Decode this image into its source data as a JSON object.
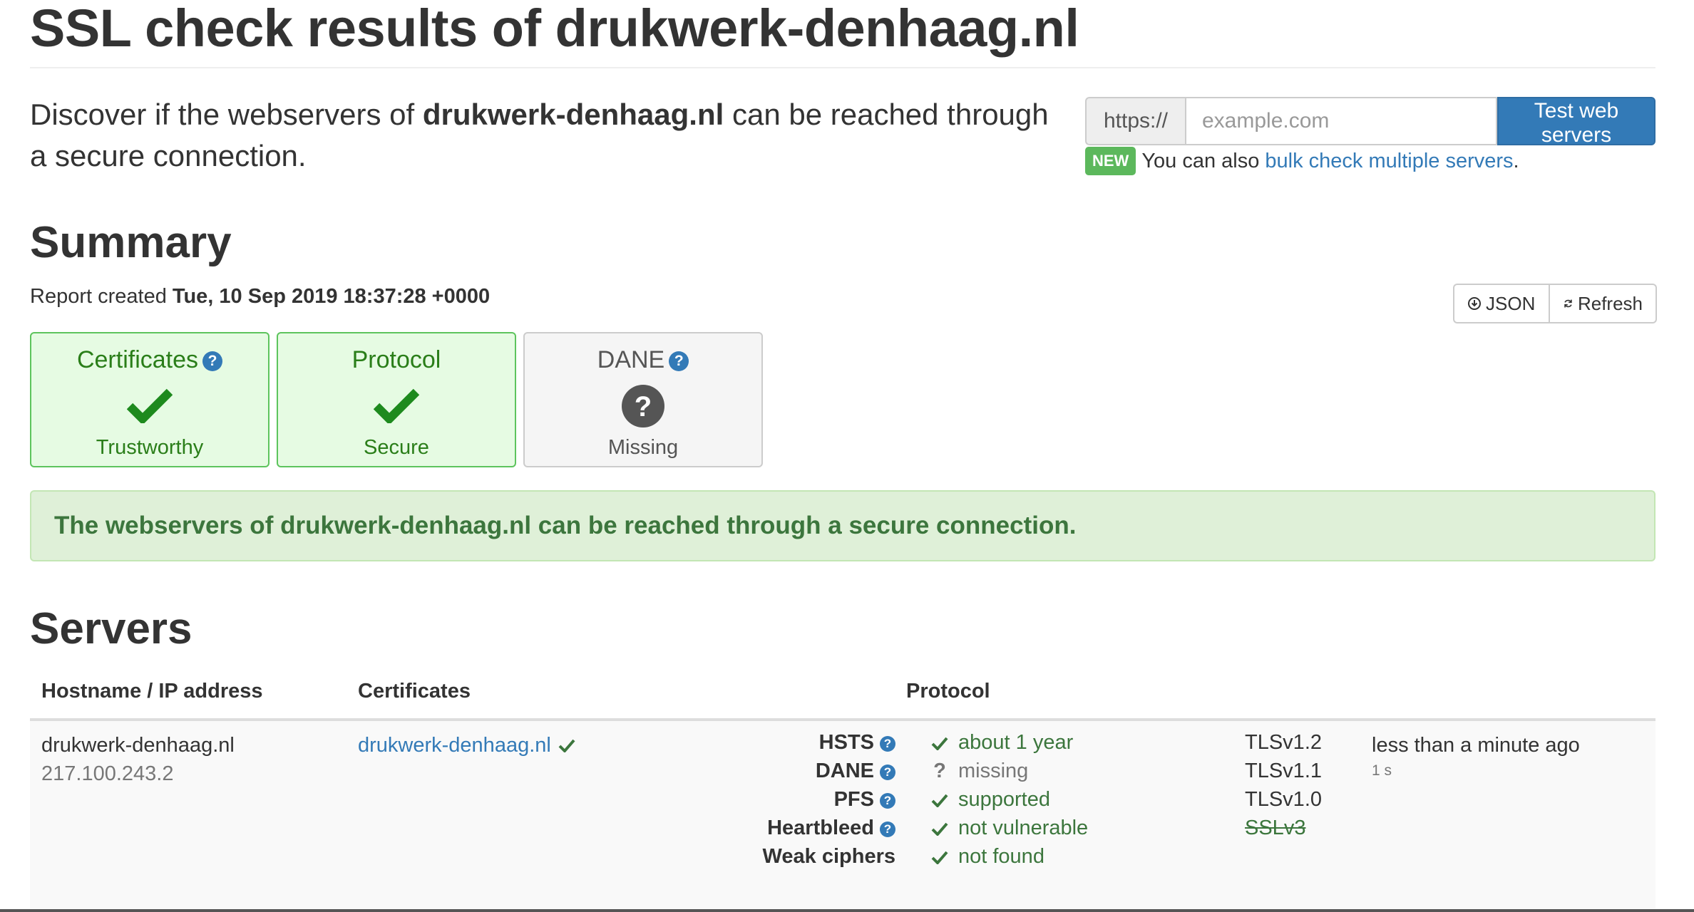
{
  "header": {
    "title": "SSL check results of drukwerk-denhaag.nl",
    "intro_prefix": "Discover if the webservers of ",
    "intro_domain": "drukwerk-denhaag.nl",
    "intro_suffix": " can be reached through a secure connection."
  },
  "search": {
    "prefix": "https://",
    "placeholder": "example.com",
    "value": "",
    "button_label": "Test web servers",
    "badge": "NEW",
    "bulk_text": "You can also ",
    "bulk_link": "bulk check multiple servers",
    "bulk_end": "."
  },
  "summary": {
    "heading": "Summary",
    "report_prefix": "Report created ",
    "report_date": "Tue, 10 Sep 2019 18:37:28 +0000",
    "json_label": "JSON",
    "refresh_label": "Refresh",
    "cards": [
      {
        "title": "Certificates",
        "status": "Trustworthy",
        "icon": "check-icon",
        "help": "?"
      },
      {
        "title": "Protocol",
        "status": "Secure",
        "icon": "check-icon"
      },
      {
        "title": "DANE",
        "status": "Missing",
        "icon": "question-icon",
        "help": "?"
      }
    ],
    "alert": "The webservers of drukwerk-denhaag.nl can be reached through a secure connection."
  },
  "servers": {
    "heading": "Servers",
    "columns": [
      "Hostname / IP address",
      "Certificates",
      "Protocol"
    ],
    "rows": [
      {
        "hostname": "drukwerk-denhaag.nl",
        "ip": "217.100.243.2",
        "certificate": "drukwerk-denhaag.nl",
        "protocol": [
          {
            "label": "HSTS",
            "value": "about 1 year",
            "status": "ok",
            "help": "?"
          },
          {
            "label": "DANE",
            "value": "missing",
            "status": "unknown",
            "help": "?"
          },
          {
            "label": "PFS",
            "value": "supported",
            "status": "ok",
            "help": "?"
          },
          {
            "label": "Heartbleed",
            "value": "not vulnerable",
            "status": "ok",
            "help": "?"
          },
          {
            "label": "Weak ciphers",
            "value": "not found",
            "status": "ok"
          }
        ],
        "tls_versions": [
          "TLSv1.2",
          "TLSv1.1",
          "TLSv1.0",
          "SSLv3"
        ],
        "checked": "less than a minute ago",
        "duration": "1 s"
      }
    ]
  },
  "colors": {
    "accent": "#337ab7",
    "success": "#3c763d",
    "success_icon": "#1e8a1e",
    "alert_bg": "#dff0d8",
    "question_icon": "#555555"
  }
}
